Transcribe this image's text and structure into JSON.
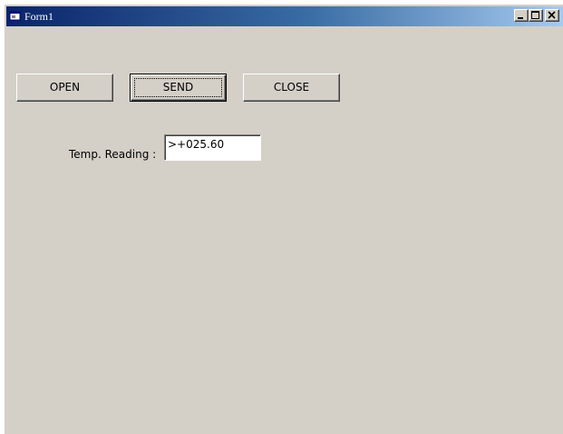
{
  "window": {
    "title": "Form1",
    "icon": "vb-form-icon"
  },
  "caption_buttons": {
    "minimize": "minimize-icon",
    "maximize": "maximize-icon",
    "close": "close-icon"
  },
  "buttons": {
    "open_label": "OPEN",
    "send_label": "SEND",
    "close_label": "CLOSE"
  },
  "temp": {
    "label": "Temp. Reading :",
    "value": ">+025.60"
  },
  "colors": {
    "title_start": "#0a246a",
    "title_end": "#a6caf0",
    "face": "#d4d0c8"
  }
}
